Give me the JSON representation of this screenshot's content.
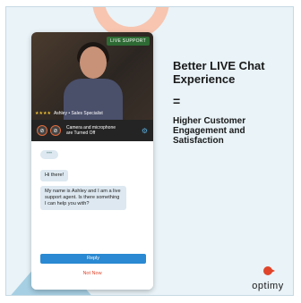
{
  "video": {
    "live_badge": "LIVE SUPPORT",
    "rating_stars": "★★★★",
    "agent_label": "Ashley • Sales Specialist"
  },
  "controls": {
    "status_text": "Camera and microphone are Turned Off"
  },
  "chat": {
    "typing_indicator": "•••",
    "messages": [
      "Hi there!",
      "My name is Ashley and I am a live support agent. Is there something I can help you with?"
    ],
    "reply_label": "Reply",
    "not_now_label": "Not Now"
  },
  "headline": {
    "title": "Better LIVE Chat Experience",
    "equals": "=",
    "subtitle": "Higher Customer Engagement and Satisfaction"
  },
  "brand": {
    "name": "optimy",
    "accent": "#e0442a",
    "button_blue": "#2a89d2"
  }
}
